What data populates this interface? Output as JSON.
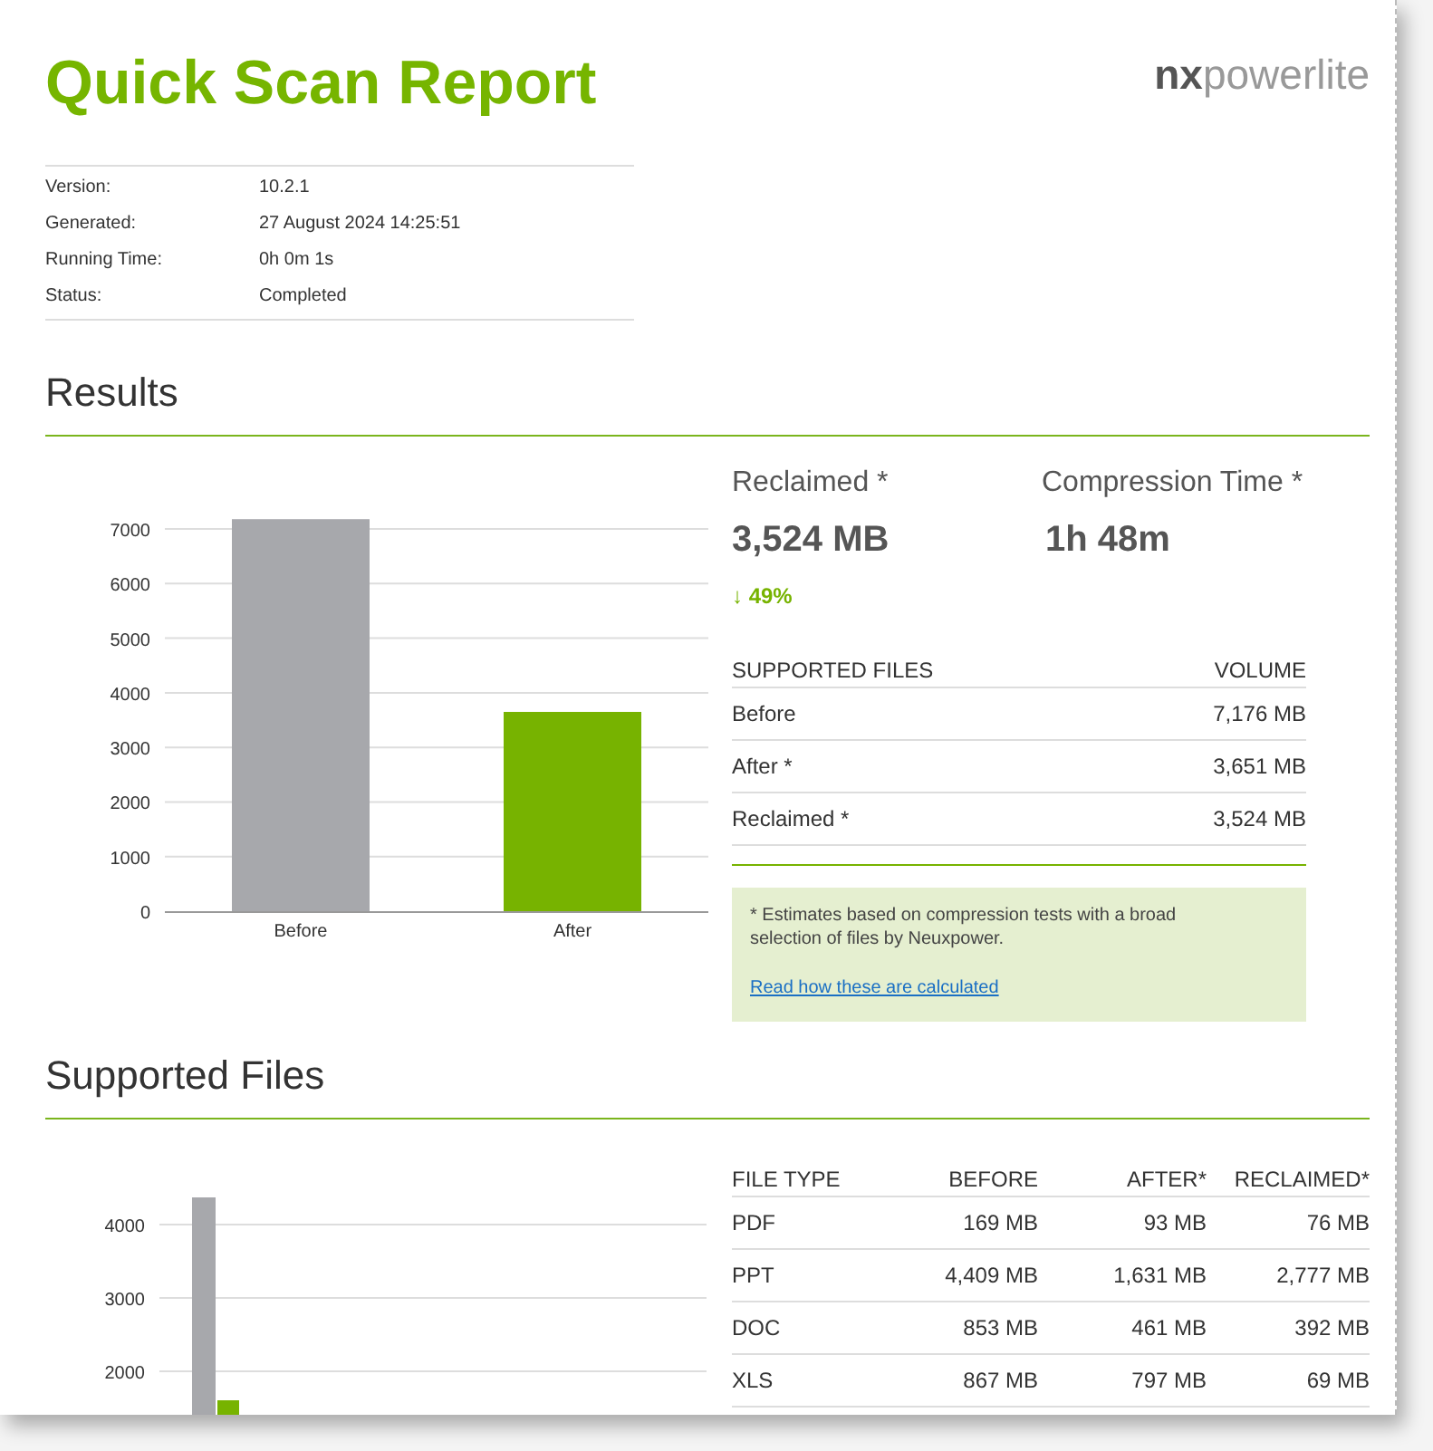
{
  "title": "Quick Scan Report",
  "logo": "**nx**powerlite",
  "info": [
    {
      "label": "Version:",
      "value": "10.2.1"
    },
    {
      "label": "Generated:",
      "value": "27 August 2024 14:25:51"
    },
    {
      "label": "Running Time:",
      "value": "0h 0m 1s"
    },
    {
      "label": "Status:",
      "value": "Completed"
    }
  ],
  "results": {
    "heading": "Results",
    "chart_data": {
      "type": "bar",
      "categories": [
        "Before",
        "After"
      ],
      "values": [
        7180,
        3650
      ],
      "colors": [
        "#a7a8ac",
        "#77b300"
      ],
      "ylim": [
        0,
        7200
      ],
      "grid": true,
      "yticks": [
        0,
        1000,
        2000,
        3000,
        4000,
        5000,
        6000,
        7000
      ]
    },
    "stats": [
      {
        "label": "Reclaimed *",
        "value": "3,524 MB"
      },
      {
        "label": "Compression Time *",
        "value": "1h 48m"
      }
    ],
    "change": "↓ 49%",
    "table": {
      "columns": [
        "SUPPORTED FILES",
        "VOLUME"
      ],
      "rows": [
        [
          "Before",
          "7,176 MB"
        ],
        [
          "After *",
          "3,651 MB"
        ],
        [
          "Reclaimed *",
          "3,524 MB"
        ]
      ]
    },
    "note": {
      "text": "* Estimates based on compression tests with a broad selection of files by Neuxpower.",
      "link": "Read how these are calculated"
    }
  },
  "supported": {
    "heading": "Supported Files",
    "chart_axis_labels": [
      "4000",
      "3000",
      "2000"
    ],
    "table": {
      "columns": [
        "FILE TYPE",
        "BEFORE",
        "AFTER*",
        "RECLAIMED*"
      ],
      "rows": [
        [
          "PDF",
          "169 MB",
          "93 MB",
          "76 MB"
        ],
        [
          "PPT",
          "4,409 MB",
          "1,631 MB",
          "2,777 MB"
        ],
        [
          "DOC",
          "853 MB",
          "461 MB",
          "392 MB"
        ],
        [
          "XLS",
          "867 MB",
          "797 MB",
          "69 MB"
        ]
      ]
    }
  }
}
